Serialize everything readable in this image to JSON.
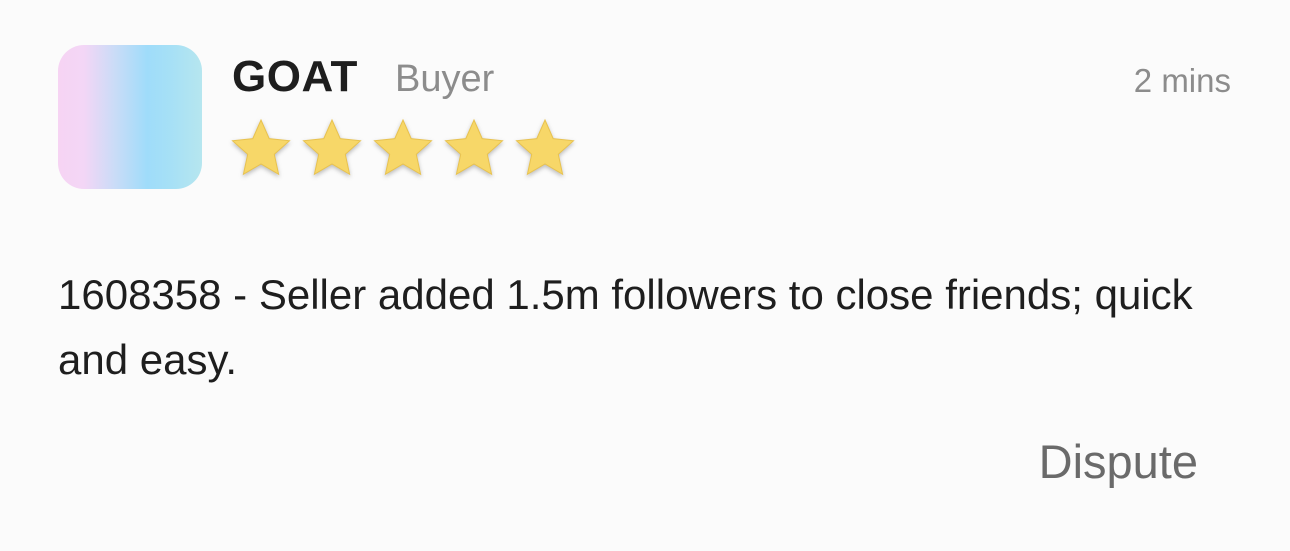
{
  "review": {
    "author": "GOAT",
    "role": "Buyer",
    "time": "2 mins",
    "rating": 5,
    "rating_max": 5,
    "text": "1608358 - Seller added 1.5m followers to close friends; quick and easy.",
    "dispute_label": "Dispute"
  },
  "colors": {
    "star": "#f7d768",
    "text": "#1e1e1e",
    "muted": "#8c8c8c"
  }
}
